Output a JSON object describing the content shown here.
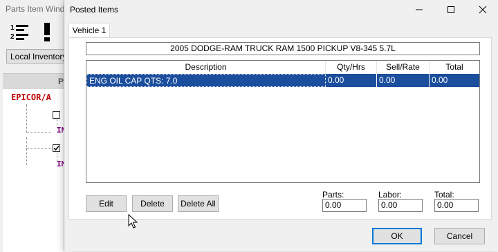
{
  "background_window": {
    "title": "Parts Item Wind",
    "local_inventory_label": "Local Inventory",
    "panel_header": "P",
    "tree_root": "EPICOR/A",
    "tree_child_1": "IN",
    "tree_child_2": "IN"
  },
  "dialog": {
    "title": "Posted Items",
    "tab_label": "Vehicle 1",
    "vehicle": "2005 DODGE-RAM TRUCK RAM 1500 PICKUP V8-345  5.7L",
    "columns": {
      "description": "Description",
      "qty": "Qty/Hrs",
      "sell": "Sell/Rate",
      "total": "Total"
    },
    "rows": [
      {
        "description": "ENG OIL CAP QTS: 7.0",
        "qty": "0.00",
        "sell": "0.00",
        "total": "0.00"
      }
    ],
    "buttons": {
      "edit": "Edit",
      "delete": "Delete",
      "delete_all": "Delete All",
      "ok": "OK",
      "cancel": "Cancel"
    },
    "totals": {
      "parts_label": "Parts:",
      "parts_value": "0.00",
      "labor_label": "Labor:",
      "labor_value": "0.00",
      "total_label": "Total:",
      "total_value": "0.00"
    }
  },
  "colors": {
    "selection": "#1c4e9e",
    "tree_root": "#c00000",
    "tree_child": "#800080",
    "focus_border": "#0078d7"
  }
}
